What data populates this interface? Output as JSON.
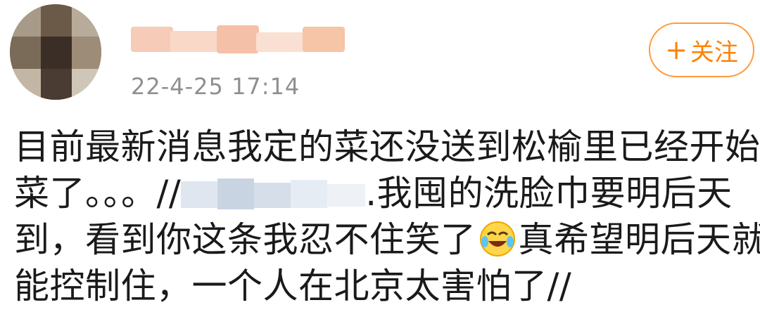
{
  "post": {
    "timestamp": "22-4-25 17:14",
    "follow_button": {
      "plus": "+",
      "label": "关注"
    },
    "content": {
      "line1": "目前最新消息我定的菜还没送到松榆里已经开始发",
      "line2_before": "菜了。。。//",
      "line2_after": ".我囤的洗脸巾要明后天",
      "line3_before": "到，看到你这条我忍不住笑了",
      "line3_after": "真希望明后天就",
      "line4": "能控制住，一个人在北京太害怕了//"
    },
    "emoji": "laugh-cry-icon",
    "colors": {
      "accent": "#ff8200",
      "timestamp": "#8f8f8f",
      "text": "#1a1a1a"
    }
  }
}
